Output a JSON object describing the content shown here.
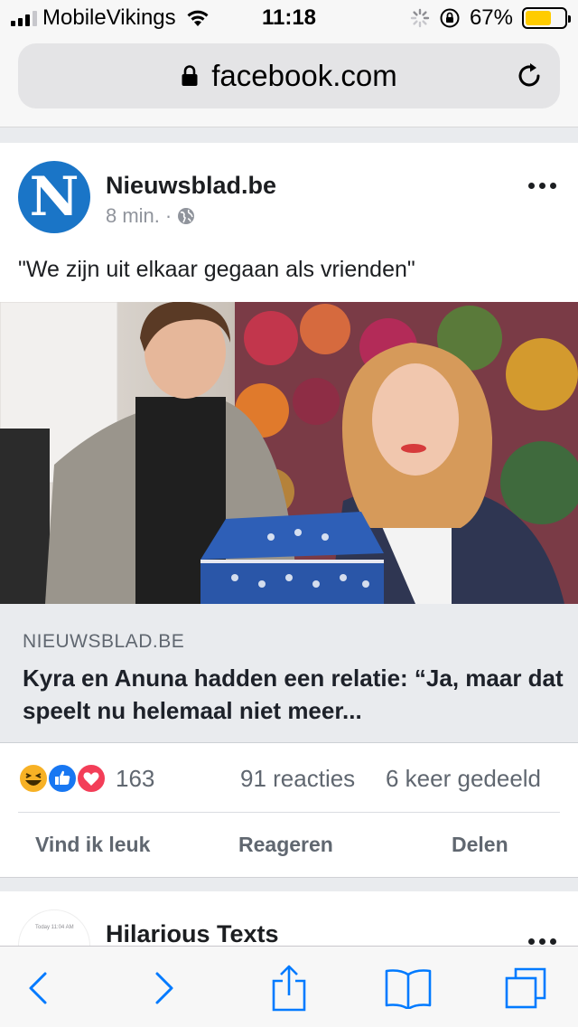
{
  "status_bar": {
    "carrier": "MobileVikings",
    "time": "11:18",
    "battery_percent": "67%",
    "battery_level": 0.67,
    "battery_color": "#ffcc00"
  },
  "browser": {
    "url": "facebook.com"
  },
  "post": {
    "page_name": "Nieuwsblad.be",
    "avatar_letter": "N",
    "timestamp": "8 min.",
    "separator": "·",
    "privacy_icon": "globe-icon",
    "text": "\"We zijn uit elkaar gegaan als vrienden\"",
    "link": {
      "domain": "NIEUWSBLAD.BE",
      "title": "Kyra en Anuna hadden een relatie: “Ja, maar dat speelt nu helemaal niet meer..."
    },
    "reactions": {
      "icons": [
        "haha-icon",
        "like-icon",
        "love-icon"
      ],
      "count": "163",
      "comments": "91 reacties",
      "shares": "6 keer gedeeld"
    },
    "actions": {
      "like": "Vind ik leuk",
      "comment": "Reageren",
      "share": "Delen"
    }
  },
  "next_post": {
    "page_name": "Hilarious Texts",
    "avatar_text": "Today 11:04 AM"
  },
  "colors": {
    "facebook_blue": "#1877f2",
    "nieuwsblad_blue": "#1a75c7",
    "ios_blue": "#007aff",
    "love_red": "#f33e58",
    "haha_yellow": "#f7b125"
  }
}
